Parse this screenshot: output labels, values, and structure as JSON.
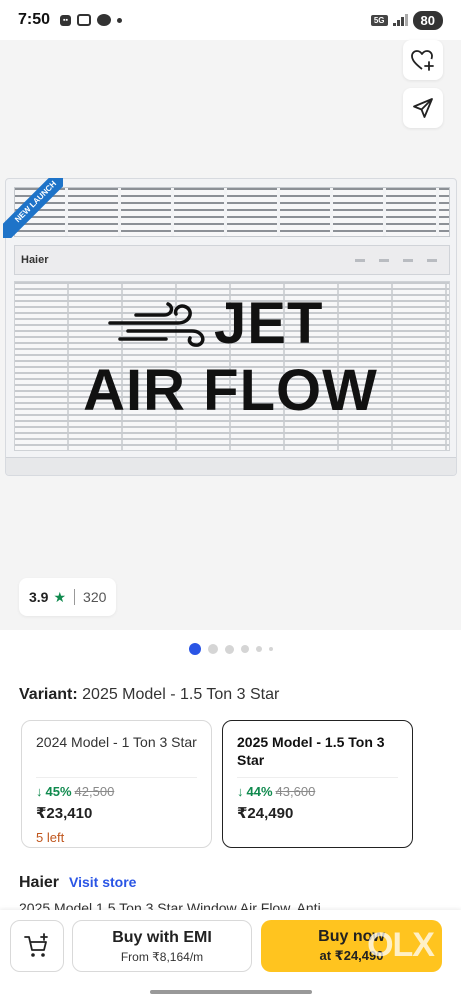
{
  "status_bar": {
    "time": "7:50",
    "network": "5G",
    "battery": "80"
  },
  "gallery": {
    "badge": "NEW LAUNCH",
    "brand_on_unit": "Haier",
    "headline_line1": "JET",
    "headline_line2": "AIR FLOW",
    "rating": {
      "value": "3.9",
      "count": "320"
    },
    "dots": {
      "count": 6,
      "active_index": 0
    },
    "icons": {
      "wishlist": "heart-plus-icon",
      "share": "share-send-icon"
    }
  },
  "variant": {
    "label": "Variant:",
    "selected": "2025 Model  -  1.5 Ton 3 Star",
    "options": [
      {
        "name": "2024 Model  -  1 Ton 3 Star",
        "discount": "45%",
        "mrp": "42,500",
        "price": "₹23,410",
        "stock": "5 left",
        "selected": false
      },
      {
        "name": "2025 Model  -  1.5 Ton 3 Star",
        "discount": "44%",
        "mrp": "43,600",
        "price": "₹24,490",
        "stock": "",
        "selected": true
      }
    ]
  },
  "seller": {
    "name": "Haier",
    "visit_store": "Visit store",
    "product_title": "2025 Model 1.5 Ton 3 Star Window Air Flow, Anti"
  },
  "bottom_bar": {
    "emi_label": "Buy with EMI",
    "emi_sub": "From ₹8,164/m",
    "buy_label": "Buy now",
    "buy_sub": "at ₹24,490",
    "watermark": "OLX"
  },
  "colors": {
    "accent_blue": "#2a55e5",
    "discount_green": "#108a4e",
    "buy_yellow": "#ffc41f",
    "stock_orange": "#c0561d"
  }
}
